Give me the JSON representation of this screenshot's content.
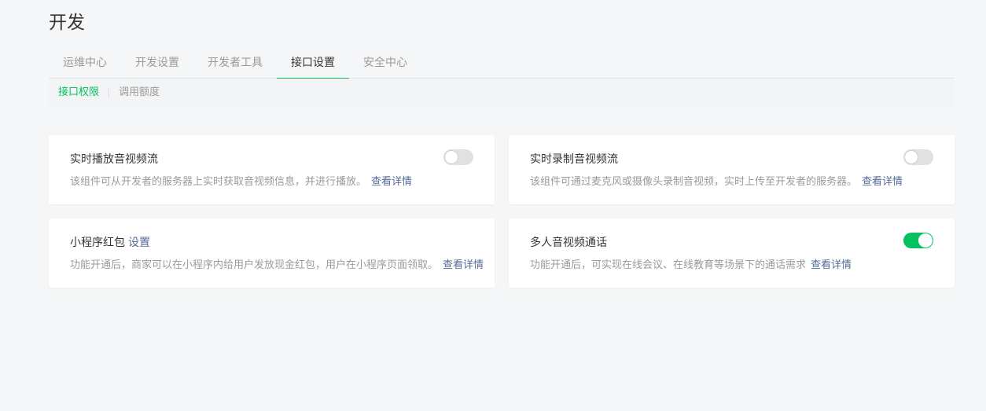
{
  "page": {
    "title": "开发"
  },
  "tabs": [
    {
      "label": "运维中心",
      "active": false
    },
    {
      "label": "开发设置",
      "active": false
    },
    {
      "label": "开发者工具",
      "active": false
    },
    {
      "label": "接口设置",
      "active": true
    },
    {
      "label": "安全中心",
      "active": false
    }
  ],
  "subtabs": [
    {
      "label": "接口权限",
      "active": true
    },
    {
      "label": "调用额度",
      "active": false
    }
  ],
  "cards": [
    {
      "title": "实时播放音视频流",
      "title_link": "",
      "desc": "该组件可从开发者的服务器上实时获取音视频信息，并进行播放。",
      "link": "查看详情",
      "enabled": false
    },
    {
      "title": "实时录制音视频流",
      "title_link": "",
      "desc": "该组件可通过麦克风或摄像头录制音视频，实时上传至开发者的服务器。",
      "link": "查看详情",
      "enabled": false
    },
    {
      "title": "小程序红包",
      "title_link": "设置",
      "desc": "功能开通后，商家可以在小程序内给用户发放现金红包，用户在小程序页面领取。",
      "link": "查看详情",
      "enabled": null
    },
    {
      "title": "多人音视频通话",
      "title_link": "",
      "desc": "功能开通后，可实现在线会议、在线教育等场景下的通话需求",
      "link": "查看详情",
      "enabled": true
    }
  ],
  "colors": {
    "accent": "#07c160",
    "link": "#576b95",
    "text": "#353535",
    "muted": "#9a9a9a",
    "background": "#f5f6f7"
  }
}
